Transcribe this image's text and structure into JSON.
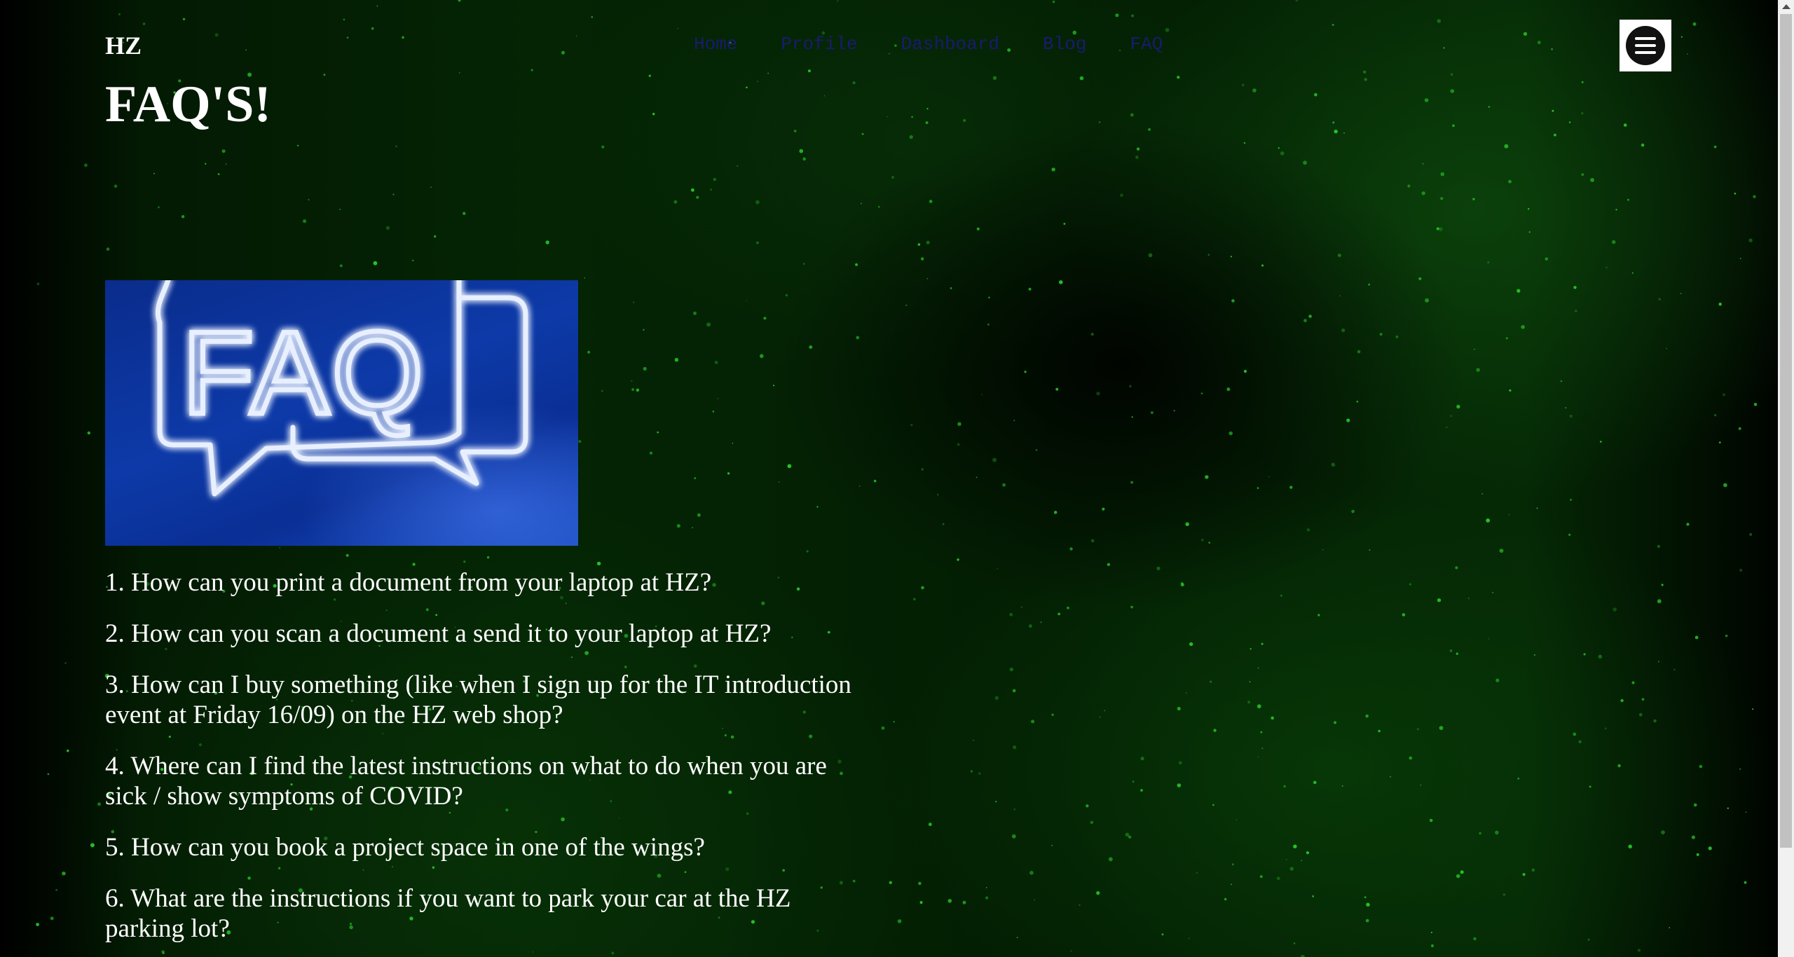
{
  "header": {
    "logo": "HZ",
    "nav": [
      "Home",
      "Profile",
      "Dashboard",
      "Blog",
      "FAQ"
    ],
    "menu_icon": "hamburger-menu-icon"
  },
  "page": {
    "title": "FAQ'S!"
  },
  "image": {
    "text": "FAQ"
  },
  "questions": [
    "1. How can you print a document from your laptop at HZ?",
    "2. How can you scan a document a send it to your laptop at HZ?",
    "3. How can I buy something (like when I sign up for the IT introduction event at Friday 16/09) on the HZ web shop?",
    "4. Where can I find the latest instructions on what to do when you are sick / show symptoms of COVID?",
    "5. How can you book a project space in one of the wings?",
    "6. What are the instructions if you want to park your car at the HZ parking lot?"
  ],
  "colors": {
    "background": "#000000",
    "accent_green": "#1f8a1f",
    "nav_text": "#1a1a70",
    "neon_blue": "#e8f0ff"
  }
}
